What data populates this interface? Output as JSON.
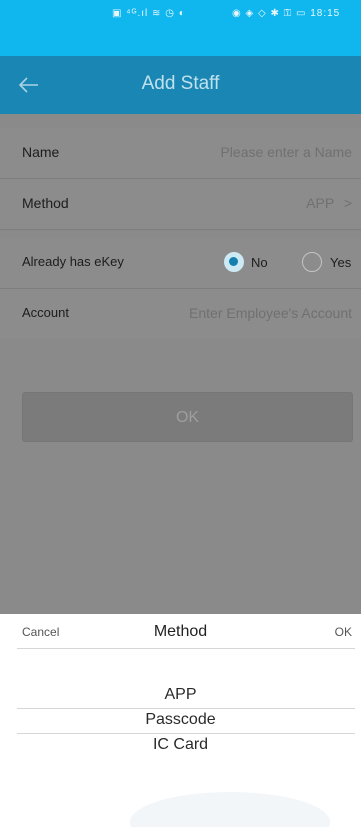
{
  "status_bar": {
    "left_icons": "▣ ⁴ᴳ.ıl ≋ ◷ ◐",
    "right_icons": "◉ ◈ ◇ ✱ ⚿ ▭ 18:15"
  },
  "header": {
    "back_icon": "back-arrow-icon",
    "title": "Add Staff"
  },
  "form": {
    "name_label": "Name",
    "name_placeholder": "Please enter a Name",
    "method_label": "Method",
    "method_value": "APP",
    "method_chevron": ">",
    "ekey_label": "Already has eKey",
    "ekey_no": "No",
    "ekey_yes": "Yes",
    "ekey_selected": "No",
    "account_label": "Account",
    "account_placeholder": "Enter Employee's Account",
    "ok_label": "OK"
  },
  "picker": {
    "cancel_label": "Cancel",
    "title": "Method",
    "ok_label": "OK",
    "options": [
      "APP",
      "Passcode",
      "IC Card"
    ],
    "selected": "APP"
  },
  "colors": {
    "status_bar": "#10b7ee",
    "header": "#1a86b3",
    "overlay": "#8a8a8a"
  }
}
